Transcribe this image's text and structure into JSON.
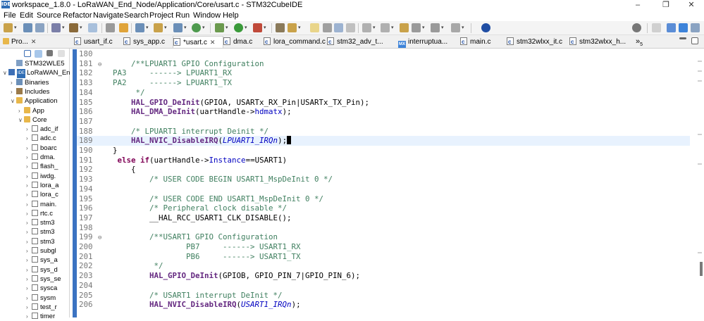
{
  "window": {
    "logo_text": "IDE",
    "title": "workspace_1.8.0 - LoRaWAN_End_Node/Application/Core/usart.c - STM32CubeIDE",
    "minimize": "–",
    "maximize": "❐",
    "close": "✕"
  },
  "menu": [
    "File",
    "Edit",
    "Source",
    "Refactor",
    "Navigate",
    "Search",
    "Project",
    "Run",
    "Window",
    "Help"
  ],
  "tabs": [
    {
      "label": "Pro...",
      "icon": "project-explorer-icon"
    },
    {
      "label": "usart_if.c",
      "icon": "c-file-icon"
    },
    {
      "label": "sys_app.c",
      "icon": "c-file-icon"
    },
    {
      "label": "*usart.c",
      "icon": "c-file-icon",
      "close": "✕"
    },
    {
      "label": "dma.c",
      "icon": "c-file-icon"
    },
    {
      "label": "lora_command.c",
      "icon": "c-file-icon"
    },
    {
      "label": "stm32_adv_t...",
      "icon": "c-file-icon"
    },
    {
      "label": "interruptua...",
      "icon": "mx-icon",
      "mx": "MX"
    },
    {
      "label": "main.c",
      "icon": "c-file-icon"
    },
    {
      "label": "stm32wlxx_it.c",
      "icon": "c-file-icon"
    },
    {
      "label": "stm32wlxx_h...",
      "icon": "c-file-icon"
    },
    {
      "label": "»",
      "icon": "overflow-icon"
    },
    {
      "label": "5",
      "icon": "overflow-count"
    }
  ],
  "explorer": {
    "close": "✕",
    "items": [
      {
        "label": "STM32WLE5",
        "depth": 1,
        "arrow": "",
        "icon": "chip-icon"
      },
      {
        "label": "LoRaWAN_Enc",
        "depth": 0,
        "arrow": "∨",
        "icon": "project-icon",
        "badge": "IDE"
      },
      {
        "label": "Binaries",
        "depth": 1,
        "arrow": "›",
        "icon": "binaries-icon"
      },
      {
        "label": "Includes",
        "depth": 1,
        "arrow": "›",
        "icon": "includes-icon"
      },
      {
        "label": "Application",
        "depth": 1,
        "arrow": "∨",
        "icon": "folder-icon"
      },
      {
        "label": "App",
        "depth": 2,
        "arrow": "›",
        "icon": "folder-icon"
      },
      {
        "label": "Core",
        "depth": 2,
        "arrow": "∨",
        "icon": "folder-icon"
      },
      {
        "label": "adc_if",
        "depth": 3,
        "arrow": "›",
        "icon": "file-icon"
      },
      {
        "label": "adc.c",
        "depth": 3,
        "arrow": "›",
        "icon": "file-icon"
      },
      {
        "label": "boarc",
        "depth": 3,
        "arrow": "›",
        "icon": "file-icon"
      },
      {
        "label": "dma.",
        "depth": 3,
        "arrow": "›",
        "icon": "file-icon"
      },
      {
        "label": "flash_",
        "depth": 3,
        "arrow": "›",
        "icon": "file-icon"
      },
      {
        "label": "iwdg.",
        "depth": 3,
        "arrow": "›",
        "icon": "file-icon"
      },
      {
        "label": "lora_a",
        "depth": 3,
        "arrow": "›",
        "icon": "file-icon"
      },
      {
        "label": "lora_c",
        "depth": 3,
        "arrow": "›",
        "icon": "file-icon"
      },
      {
        "label": "main.",
        "depth": 3,
        "arrow": "›",
        "icon": "file-icon"
      },
      {
        "label": "rtc.c",
        "depth": 3,
        "arrow": "›",
        "icon": "file-icon"
      },
      {
        "label": "stm3",
        "depth": 3,
        "arrow": "›",
        "icon": "file-icon"
      },
      {
        "label": "stm3",
        "depth": 3,
        "arrow": "›",
        "icon": "file-icon"
      },
      {
        "label": "stm3",
        "depth": 3,
        "arrow": "›",
        "icon": "file-icon"
      },
      {
        "label": "subgl",
        "depth": 3,
        "arrow": "›",
        "icon": "file-icon"
      },
      {
        "label": "sys_a",
        "depth": 3,
        "arrow": "›",
        "icon": "file-icon"
      },
      {
        "label": "sys_d",
        "depth": 3,
        "arrow": "›",
        "icon": "file-icon"
      },
      {
        "label": "sys_se",
        "depth": 3,
        "arrow": "›",
        "icon": "file-icon"
      },
      {
        "label": "sysca",
        "depth": 3,
        "arrow": "›",
        "icon": "file-icon"
      },
      {
        "label": "sysm",
        "depth": 3,
        "arrow": "›",
        "icon": "file-icon"
      },
      {
        "label": "test_r",
        "depth": 3,
        "arrow": "›",
        "icon": "file-icon"
      },
      {
        "label": "timer",
        "depth": 3,
        "arrow": "›",
        "icon": "file-icon"
      }
    ]
  },
  "editor": {
    "lines": [
      {
        "n": "180",
        "fold": "",
        "segs": [
          [
            "code",
            ""
          ]
        ]
      },
      {
        "n": "181",
        "fold": "⊖",
        "segs": [
          [
            "cmt",
            "      /**LPUART1 GPIO Configuration"
          ]
        ]
      },
      {
        "n": "182",
        "fold": "",
        "segs": [
          [
            "cmt",
            "  PA3     ------> LPUART1_RX"
          ]
        ]
      },
      {
        "n": "183",
        "fold": "",
        "segs": [
          [
            "cmt",
            "  PA2     ------> LPUART1_TX"
          ]
        ]
      },
      {
        "n": "184",
        "fold": "",
        "segs": [
          [
            "cmt",
            "       */"
          ]
        ]
      },
      {
        "n": "185",
        "fold": "",
        "segs": [
          [
            "code",
            "      "
          ],
          [
            "fn",
            "HAL_GPIO_DeInit"
          ],
          [
            "code",
            "(GPIOA, USARTx_RX_Pin|USARTx_TX_Pin);"
          ]
        ]
      },
      {
        "n": "186",
        "fold": "",
        "segs": [
          [
            "code",
            "      "
          ],
          [
            "fn",
            "HAL_DMA_DeInit"
          ],
          [
            "code",
            "(uartHandle->"
          ],
          [
            "fld",
            "hdmatx"
          ],
          [
            "code",
            ");"
          ]
        ]
      },
      {
        "n": "187",
        "fold": "",
        "segs": [
          [
            "code",
            ""
          ]
        ]
      },
      {
        "n": "188",
        "fold": "",
        "segs": [
          [
            "cmt",
            "      /* LPUART1 interrupt Deinit */"
          ]
        ]
      },
      {
        "n": "189",
        "fold": "",
        "current": true,
        "segs": [
          [
            "code",
            "      "
          ],
          [
            "fn",
            "HAL_NVIC_DisableIRQ"
          ],
          [
            "code",
            "("
          ],
          [
            "mac",
            "LPUART1_IRQn"
          ],
          [
            "code",
            ");"
          ],
          [
            "cursor",
            ""
          ]
        ]
      },
      {
        "n": "190",
        "fold": "",
        "segs": [
          [
            "code",
            "  }"
          ]
        ]
      },
      {
        "n": "191",
        "fold": "",
        "segs": [
          [
            "code",
            "   "
          ],
          [
            "kw",
            "else if"
          ],
          [
            "code",
            "(uartHandle->"
          ],
          [
            "fld",
            "Instance"
          ],
          [
            "code",
            "==USART1)"
          ]
        ]
      },
      {
        "n": "192",
        "fold": "",
        "segs": [
          [
            "code",
            "      {"
          ]
        ]
      },
      {
        "n": "193",
        "fold": "",
        "segs": [
          [
            "cmt",
            "          /* USER CODE BEGIN USART1_MspDeInit 0 */"
          ]
        ]
      },
      {
        "n": "194",
        "fold": "",
        "segs": [
          [
            "code",
            ""
          ]
        ]
      },
      {
        "n": "195",
        "fold": "",
        "segs": [
          [
            "cmt",
            "          /* USER CODE END USART1_MspDeInit 0 */"
          ]
        ]
      },
      {
        "n": "196",
        "fold": "",
        "segs": [
          [
            "cmt",
            "          /* Peripheral clock disable */"
          ]
        ]
      },
      {
        "n": "197",
        "fold": "",
        "segs": [
          [
            "code",
            "          __HAL_RCC_USART1_CLK_DISABLE();"
          ]
        ]
      },
      {
        "n": "198",
        "fold": "",
        "segs": [
          [
            "code",
            ""
          ]
        ]
      },
      {
        "n": "199",
        "fold": "⊖",
        "segs": [
          [
            "cmt",
            "          /**USART1 GPIO Configuration"
          ]
        ]
      },
      {
        "n": "200",
        "fold": "",
        "segs": [
          [
            "cmt",
            "                  PB7     ------> USART1_RX"
          ]
        ]
      },
      {
        "n": "201",
        "fold": "",
        "segs": [
          [
            "cmt",
            "                  PB6     ------> USART1_TX"
          ]
        ]
      },
      {
        "n": "202",
        "fold": "",
        "segs": [
          [
            "cmt",
            "           */"
          ]
        ]
      },
      {
        "n": "203",
        "fold": "",
        "segs": [
          [
            "code",
            "          "
          ],
          [
            "fn",
            "HAL_GPIO_DeInit"
          ],
          [
            "code",
            "(GPIOB, GPIO_PIN_7|GPIO_PIN_6);"
          ]
        ]
      },
      {
        "n": "204",
        "fold": "",
        "segs": [
          [
            "code",
            ""
          ]
        ]
      },
      {
        "n": "205",
        "fold": "",
        "segs": [
          [
            "cmt",
            "          /* USART1 interrupt DeInit */"
          ]
        ]
      },
      {
        "n": "206",
        "fold": "",
        "segs": [
          [
            "code",
            "          "
          ],
          [
            "fn",
            "HAL_NVIC_DisableIRQ"
          ],
          [
            "code",
            "("
          ],
          [
            "mac",
            "USART1_IRQn"
          ],
          [
            "code",
            ");"
          ]
        ]
      }
    ]
  },
  "colors": {
    "ruler": "#3b73c2",
    "current_line": "#e8f2fe",
    "comment": "#3f7f5f",
    "function": "#642880",
    "keyword": "#7f0055",
    "field": "#0000c0"
  }
}
